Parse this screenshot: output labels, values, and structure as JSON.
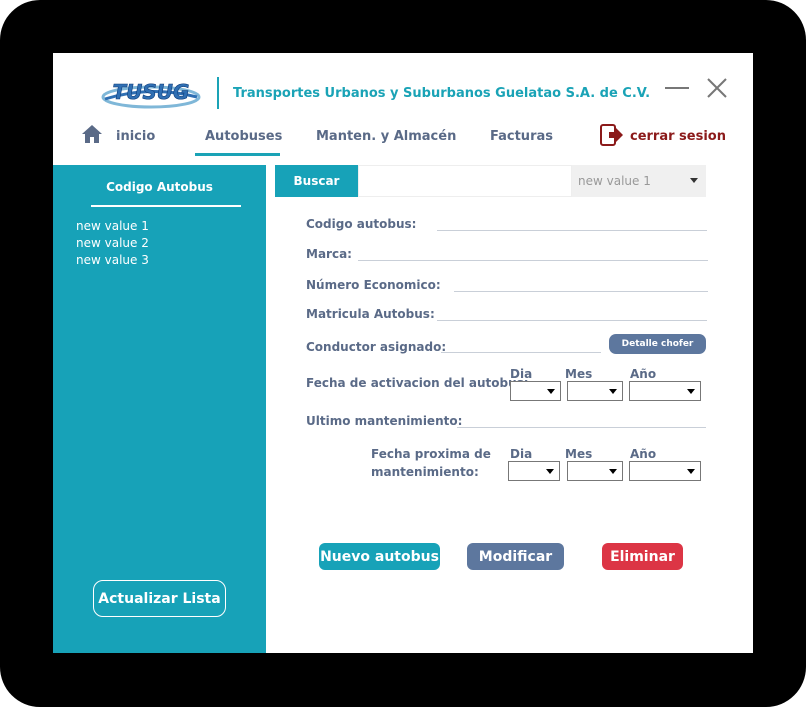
{
  "header": {
    "logo_text": "TUSUG",
    "company_name": "Transportes Urbanos y Suburbanos Guelatao S.A. de C.V."
  },
  "nav": {
    "home": "inicio",
    "tabs": [
      "Autobuses",
      "Manten. y Almacén",
      "Facturas"
    ],
    "logout": "cerrar sesion"
  },
  "sidebar": {
    "title": "Codigo Autobus",
    "items": [
      "new value 1",
      "new value 2",
      "new value 3"
    ],
    "refresh_label": "Actualizar Lista"
  },
  "search": {
    "button_label": "Buscar",
    "input_value": "",
    "select_value": "new value 1"
  },
  "form": {
    "codigo_label": "Codigo autobus:",
    "marca_label": "Marca:",
    "numero_label": "Número Economico:",
    "matricula_label": "Matricula Autobus:",
    "conductor_label": "Conductor asignado:",
    "driver_button": "Detalle chofer",
    "fecha_activacion_label": "Fecha de activacion del autobus:",
    "ultimo_label": "Ultimo mantenimiento:",
    "proxima_label_1": "Fecha proxima de",
    "proxima_label_2": "mantenimiento:",
    "dia": "Dia",
    "mes": "Mes",
    "anio": "Año"
  },
  "actions": {
    "new": "Nuevo autobus",
    "edit": "Modificar",
    "delete": "Eliminar"
  },
  "colors": {
    "accent": "#17a2b8",
    "secondary": "#5d779e",
    "danger": "#dc3545",
    "logout": "#8b1a1a"
  }
}
